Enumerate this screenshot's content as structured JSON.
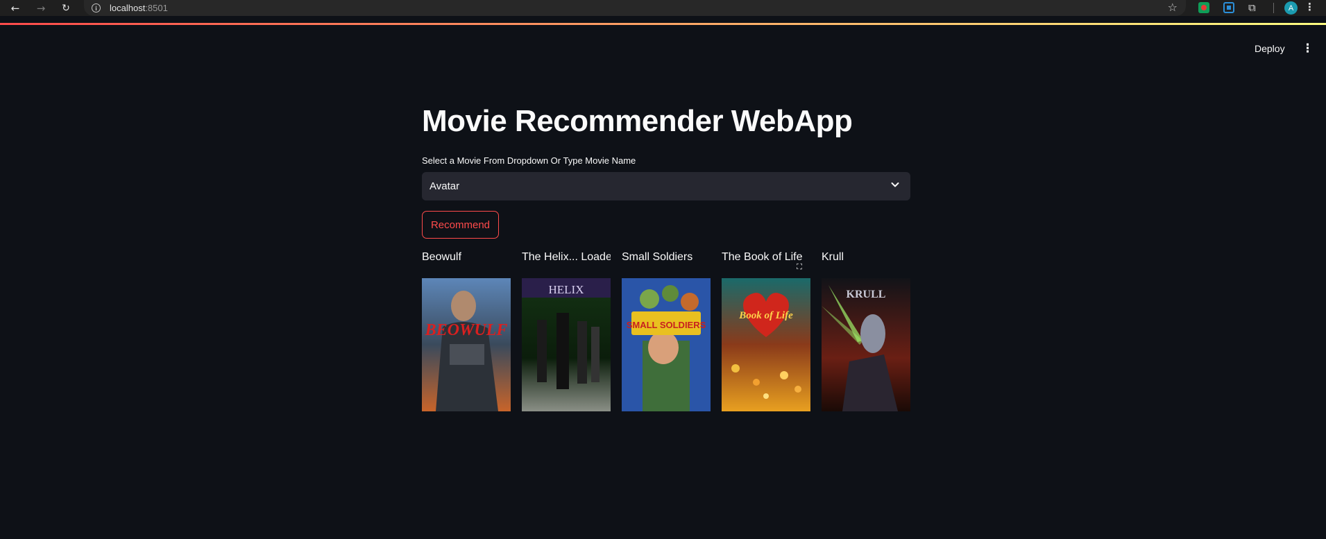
{
  "browser": {
    "url_host": "localhost",
    "url_port": ":8501",
    "profile_initial": "A"
  },
  "header": {
    "deploy_label": "Deploy"
  },
  "app": {
    "title": "Movie Recommender WebApp",
    "select_label": "Select a Movie From Dropdown Or Type Movie Name",
    "selected_movie": "Avatar",
    "recommend_label": "Recommend"
  },
  "recommendations": [
    {
      "title": "Beowulf",
      "poster_text": "BEOWULF"
    },
    {
      "title": "The Helix... Loaded",
      "poster_text": "HELIX"
    },
    {
      "title": "Small Soldiers",
      "poster_text": "SMALL SOLDIERS"
    },
    {
      "title": "The Book of Life",
      "poster_text": "Book of Life"
    },
    {
      "title": "Krull",
      "poster_text": "KRULL"
    }
  ],
  "colors": {
    "background": "#0e1117",
    "accent": "#ff4b4b",
    "input_bg": "#262730",
    "text": "#fafafa"
  }
}
